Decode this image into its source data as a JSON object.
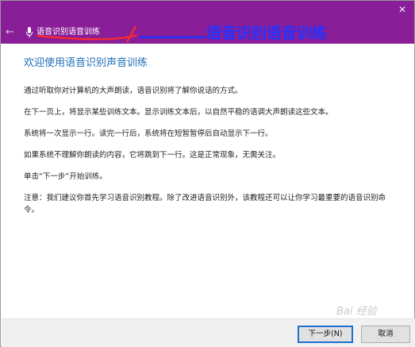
{
  "titlebar": {
    "title": "语音识别语音训练",
    "back_symbol": "←",
    "close_symbol": "✕",
    "annotation": "语音识别语音训练"
  },
  "content": {
    "heading": "欢迎使用语音识别声音训练",
    "paragraphs": [
      "通过听取你对计算机的大声朗读，语音识别将了解你说话的方式。",
      "在下一页上，将显示某些训练文本。显示训练文本后，以自然平稳的语调大声朗读这些文本。",
      "系统将一次显示一行。读完一行后，系统将在短暂暂停后自动显示下一行。",
      "如果系统不理解你朗读的内容，它将跳到下一行。这是正常现象，无需关注。",
      "单击“下一步”开始训练。",
      "注意：我们建议你首先学习语音识别教程。除了改进语音识别外，该教程还可以让你学习最重要的语音识别命令。"
    ]
  },
  "footer": {
    "next_label": "下一步(N)",
    "cancel_label": "取消"
  },
  "watermark": "Bai 经验",
  "colors": {
    "titlebar": "#8a1e99",
    "annotation": "#2233ff",
    "heading": "#1f6fb7",
    "focus_border": "#1e6fd0"
  },
  "icons": {
    "back": "back-arrow-icon",
    "close": "close-icon",
    "mic": "microphone-icon"
  }
}
